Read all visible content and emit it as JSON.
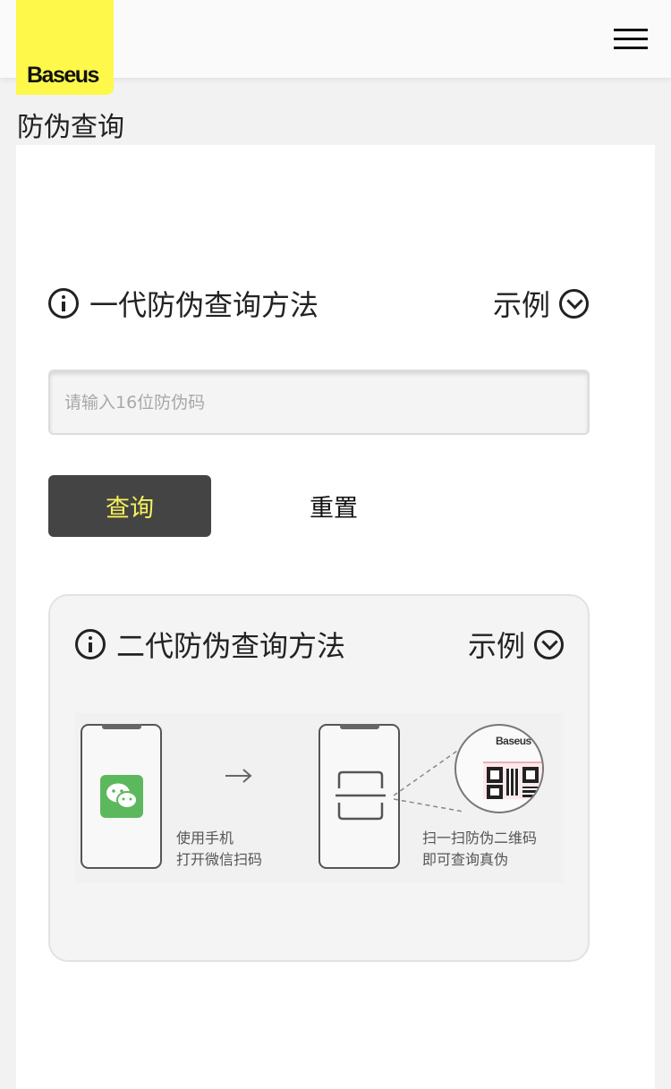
{
  "header": {
    "logo_text": "Baseus",
    "menu_icon": "hamburger-menu-icon"
  },
  "page": {
    "title": "防伪查询"
  },
  "gen1": {
    "title": "一代防伪查询方法",
    "example_label": "示例",
    "info_icon": "info-icon",
    "chevron_icon": "chevron-down-circle-icon",
    "input_placeholder": "请输入16位防伪码",
    "query_label": "查询",
    "reset_label": "重置"
  },
  "gen2": {
    "title": "二代防伪查询方法",
    "example_label": "示例",
    "info_icon": "info-icon",
    "chevron_icon": "chevron-down-circle-icon",
    "illustration": {
      "step1_line1": "使用手机",
      "step1_line2": "打开微信扫码",
      "step2_line1": "扫一扫防伪二维码",
      "step2_line2": "即可查询真伪",
      "brand_on_label": "Baseus"
    }
  },
  "colors": {
    "brand_yellow": "#fdf84a",
    "button_dark": "#444444",
    "button_text": "#f5f05a",
    "wechat_green": "#5cb85c"
  }
}
